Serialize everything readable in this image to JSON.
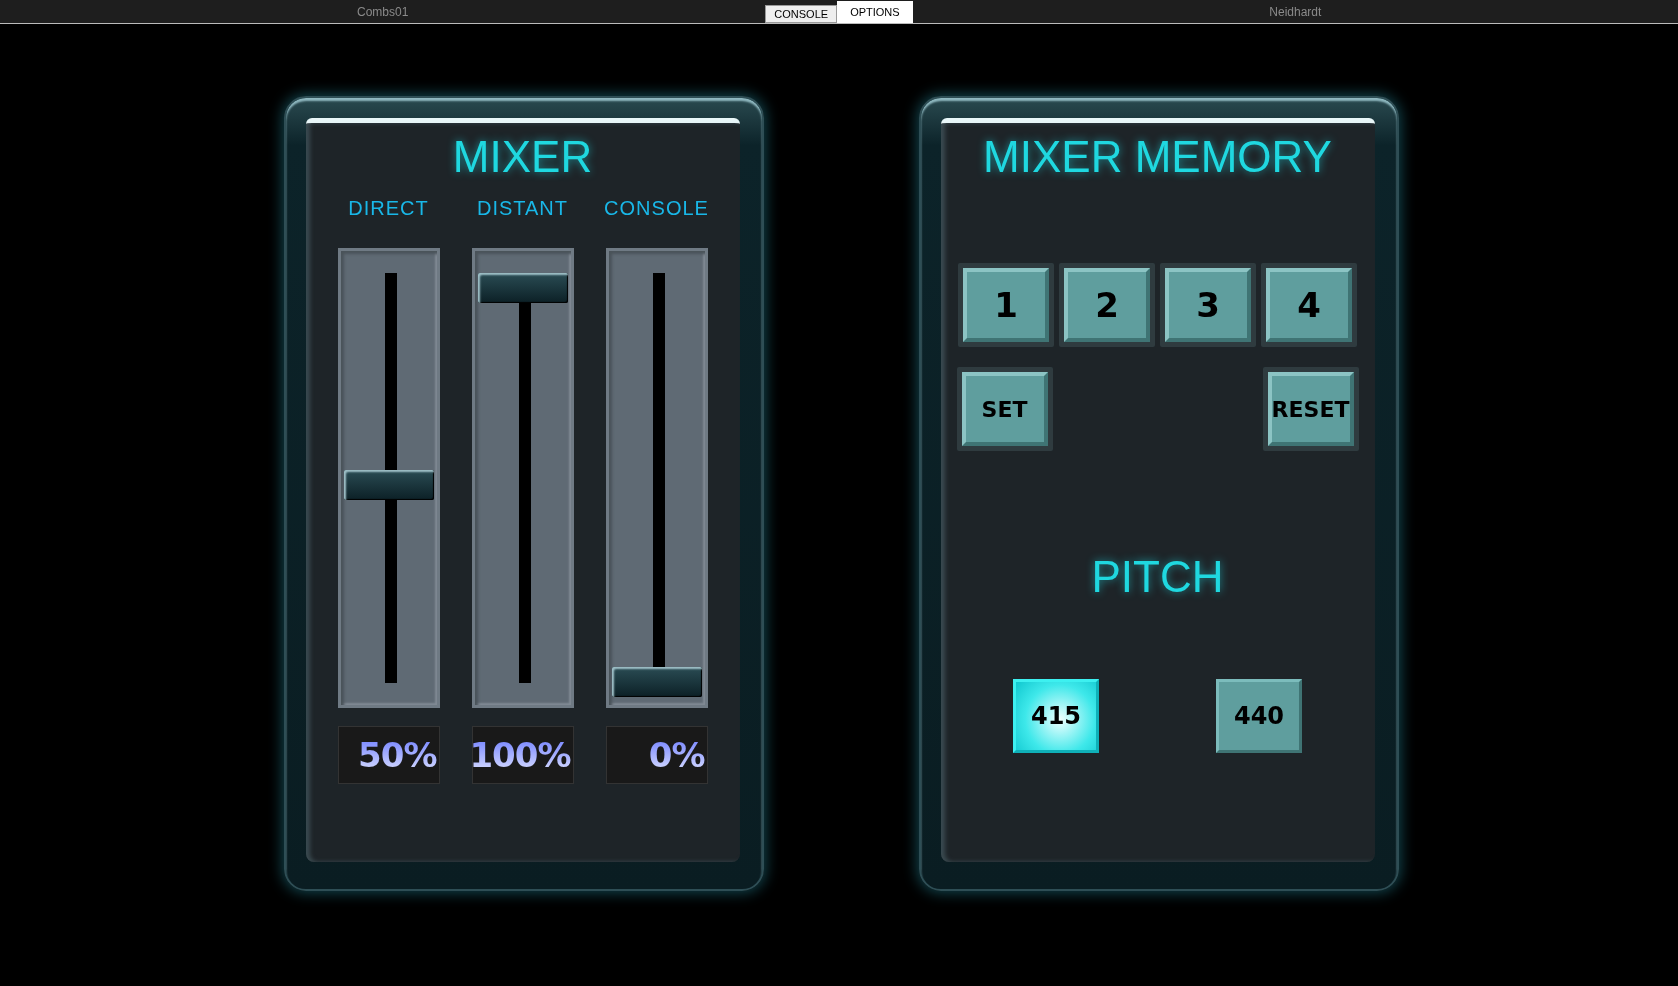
{
  "top_bar": {
    "left_text": "Combs01",
    "right_text": "Neidhardt",
    "tabs": [
      {
        "label": "CONSOLE",
        "selected": false
      },
      {
        "label": "OPTIONS",
        "selected": true
      }
    ]
  },
  "mixer": {
    "title": "MIXER",
    "channels": [
      {
        "name": "DIRECT",
        "level": 0.5,
        "reading": "50%"
      },
      {
        "name": "DISTANT",
        "level": 1,
        "reading": "100%"
      },
      {
        "name": "CONSOLE",
        "level": 0,
        "reading": "0%"
      }
    ]
  },
  "mixer_memory": {
    "title": "MIXER MEMORY",
    "slots": [
      "1",
      "2",
      "3",
      "4"
    ],
    "actions": [
      "SET",
      "RESET"
    ],
    "pitch": {
      "title": "PITCH",
      "options": [
        {
          "label": "415",
          "selected": true
        },
        {
          "label": "440",
          "selected": false
        }
      ]
    }
  }
}
